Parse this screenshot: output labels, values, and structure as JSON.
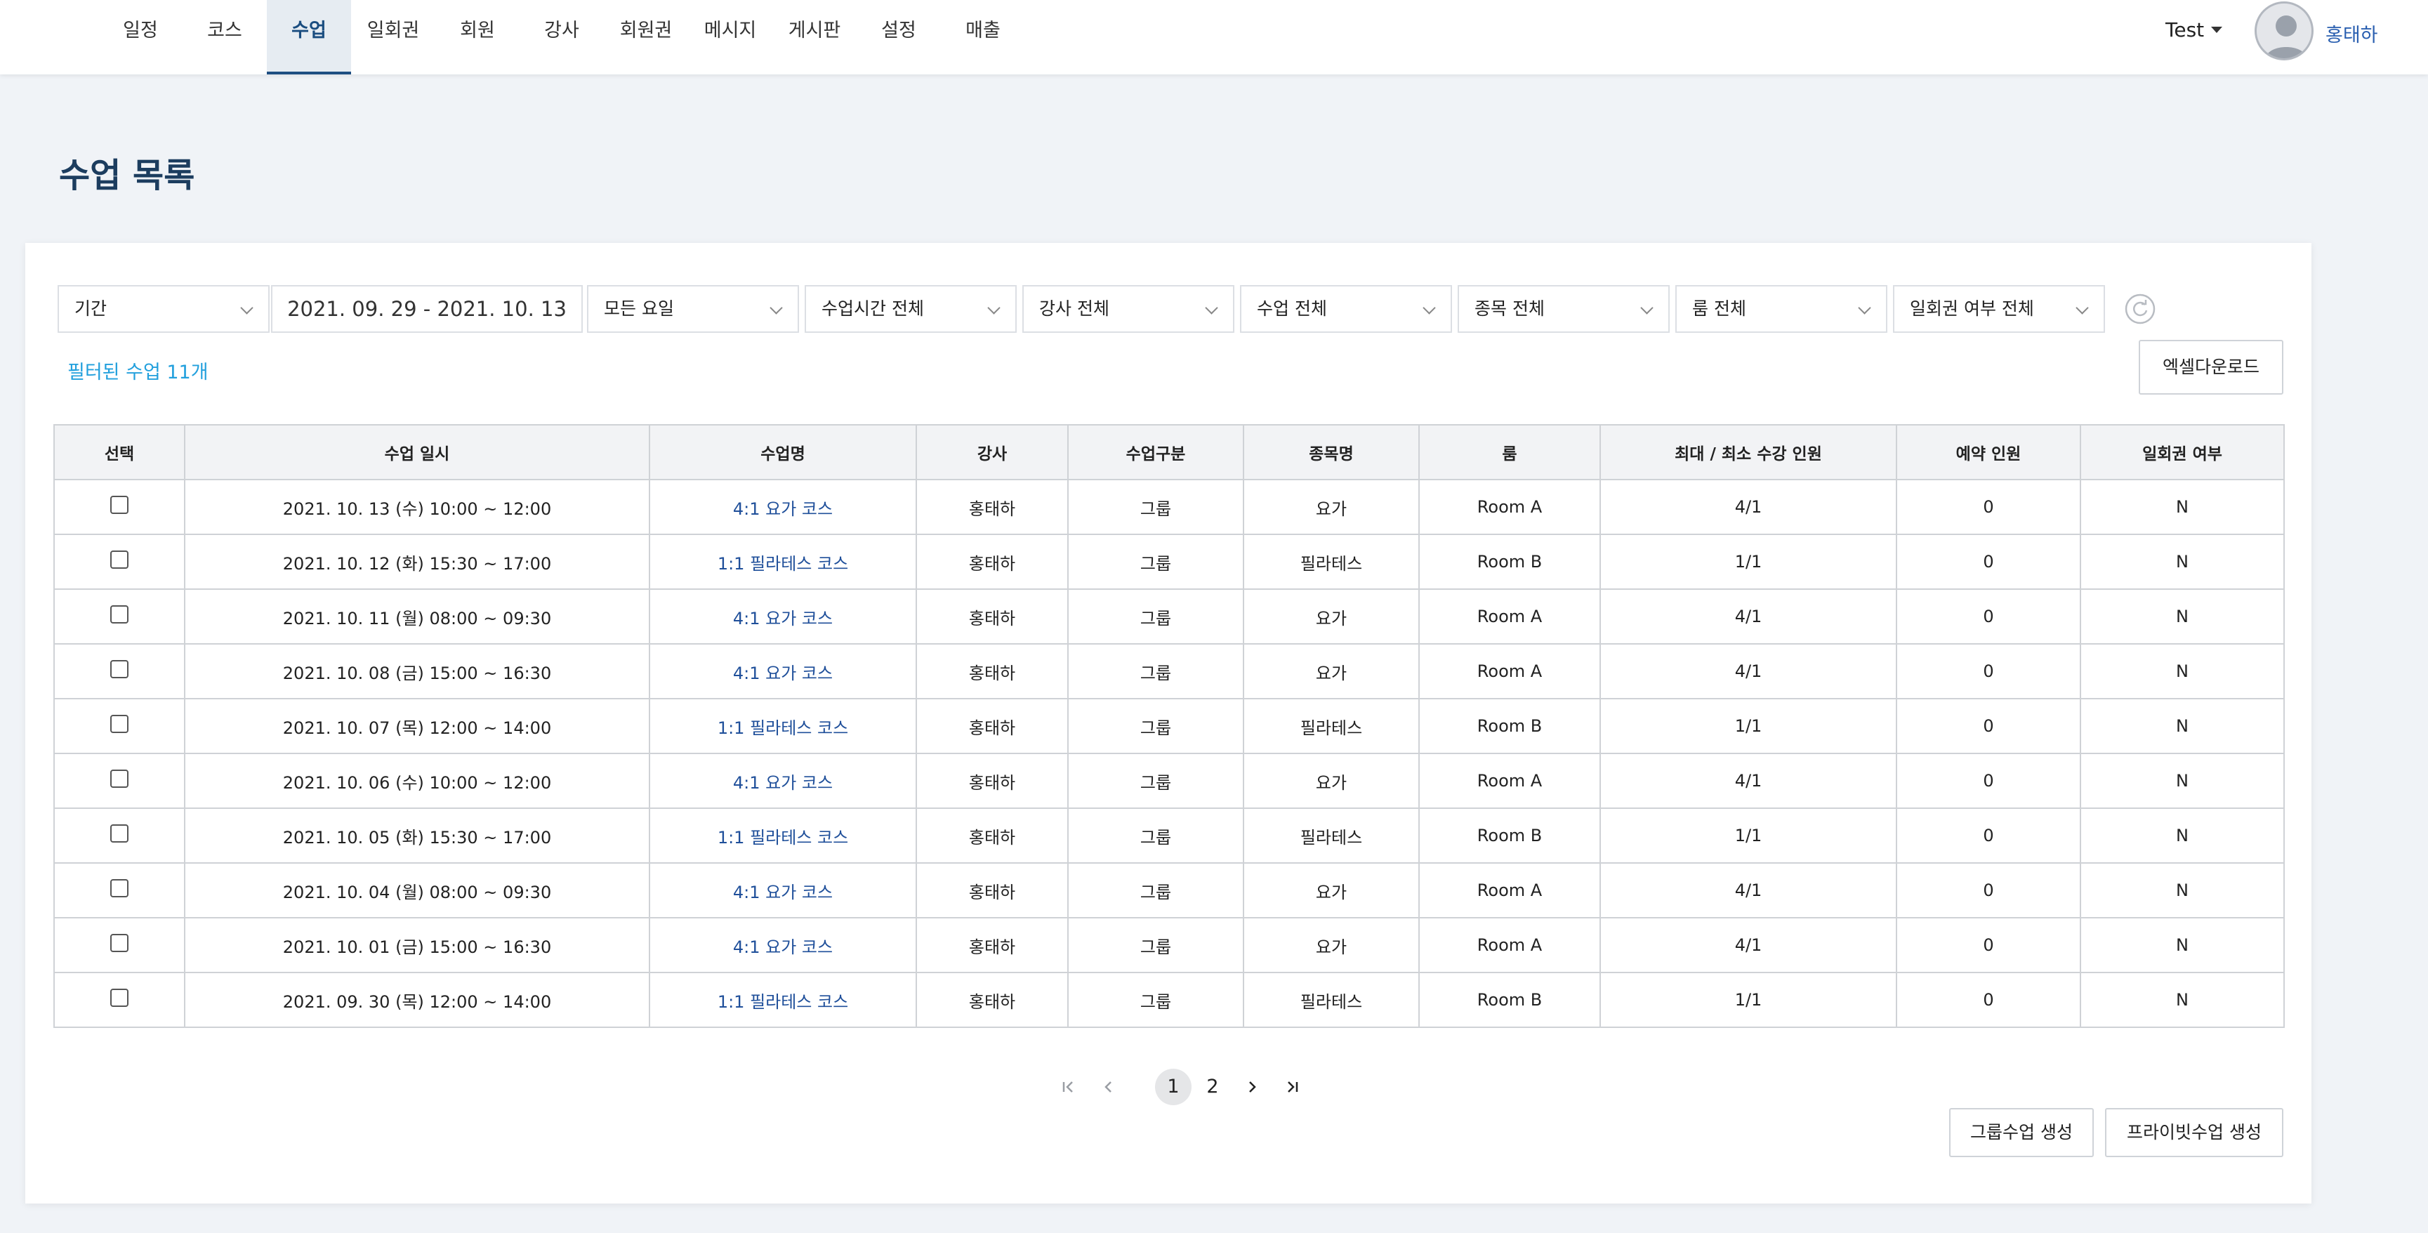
{
  "nav": {
    "items": [
      "일정",
      "코스",
      "수업",
      "일회권",
      "회원",
      "강사",
      "회원권",
      "메시지",
      "게시판",
      "설정",
      "매출"
    ],
    "active_index": 2
  },
  "account": {
    "studio": "Test",
    "user": "홍태하"
  },
  "page": {
    "title": "수업 목록"
  },
  "filters": {
    "period": "기간",
    "date_range": "2021. 09. 29 - 2021. 10. 13",
    "weekday": "모든 요일",
    "time": "수업시간 전체",
    "instructor": "강사 전체",
    "class": "수업 전체",
    "category": "종목 전체",
    "room": "룸 전체",
    "single_pass": "일회권 여부 전체"
  },
  "summary": {
    "filtered_count": "필터된 수업 11개"
  },
  "buttons": {
    "excel": "엑셀다운로드",
    "create_group": "그룹수업 생성",
    "create_private": "프라이빗수업 생성"
  },
  "table": {
    "headers": [
      "선택",
      "수업 일시",
      "수업명",
      "강사",
      "수업구분",
      "종목명",
      "룸",
      "최대 / 최소 수강 인원",
      "예약 인원",
      "일회권 여부"
    ],
    "rows": [
      [
        "2021. 10. 13 (수) 10:00 ~ 12:00",
        "4:1 요가 코스",
        "홍태하",
        "그룹",
        "요가",
        "Room A",
        "4/1",
        "0",
        "N"
      ],
      [
        "2021. 10. 12 (화) 15:30 ~ 17:00",
        "1:1 필라테스 코스",
        "홍태하",
        "그룹",
        "필라테스",
        "Room B",
        "1/1",
        "0",
        "N"
      ],
      [
        "2021. 10. 11 (월) 08:00 ~ 09:30",
        "4:1 요가 코스",
        "홍태하",
        "그룹",
        "요가",
        "Room A",
        "4/1",
        "0",
        "N"
      ],
      [
        "2021. 10. 08 (금) 15:00 ~ 16:30",
        "4:1 요가 코스",
        "홍태하",
        "그룹",
        "요가",
        "Room A",
        "4/1",
        "0",
        "N"
      ],
      [
        "2021. 10. 07 (목) 12:00 ~ 14:00",
        "1:1 필라테스 코스",
        "홍태하",
        "그룹",
        "필라테스",
        "Room B",
        "1/1",
        "0",
        "N"
      ],
      [
        "2021. 10. 06 (수) 10:00 ~ 12:00",
        "4:1 요가 코스",
        "홍태하",
        "그룹",
        "요가",
        "Room A",
        "4/1",
        "0",
        "N"
      ],
      [
        "2021. 10. 05 (화) 15:30 ~ 17:00",
        "1:1 필라테스 코스",
        "홍태하",
        "그룹",
        "필라테스",
        "Room B",
        "1/1",
        "0",
        "N"
      ],
      [
        "2021. 10. 04 (월) 08:00 ~ 09:30",
        "4:1 요가 코스",
        "홍태하",
        "그룹",
        "요가",
        "Room A",
        "4/1",
        "0",
        "N"
      ],
      [
        "2021. 10. 01 (금) 15:00 ~ 16:30",
        "4:1 요가 코스",
        "홍태하",
        "그룹",
        "요가",
        "Room A",
        "4/1",
        "0",
        "N"
      ],
      [
        "2021. 09. 30 (목) 12:00 ~ 14:00",
        "1:1 필라테스 코스",
        "홍태하",
        "그룹",
        "필라테스",
        "Room B",
        "1/1",
        "0",
        "N"
      ]
    ]
  },
  "pagination": {
    "pages": [
      "1",
      "2"
    ],
    "current": "1"
  },
  "colors": {
    "accent": "#1f4f82",
    "link": "#1f4f9a",
    "count": "#22a0dd"
  }
}
